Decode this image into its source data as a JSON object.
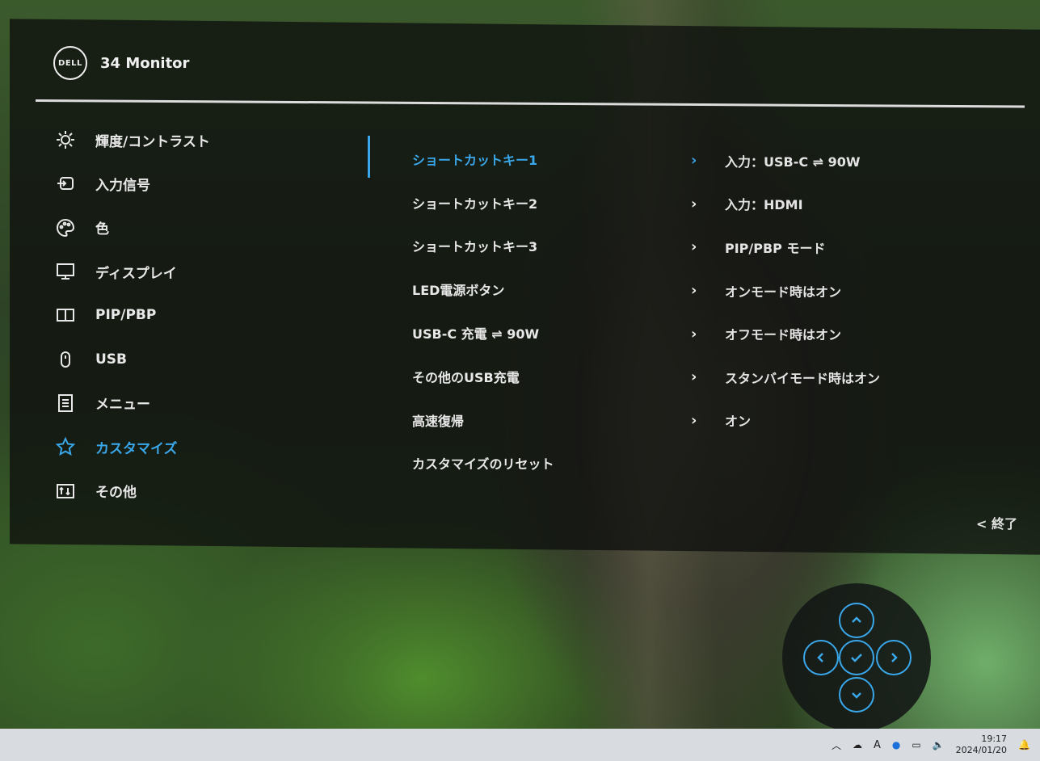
{
  "header": {
    "logo_text": "DELL",
    "title": "34 Monitor"
  },
  "categories": [
    {
      "label": "輝度/コントラスト",
      "icon": "brightness-icon",
      "active": false
    },
    {
      "label": "入力信号",
      "icon": "input-icon",
      "active": false
    },
    {
      "label": "色",
      "icon": "palette-icon",
      "active": false
    },
    {
      "label": "ディスプレイ",
      "icon": "display-icon",
      "active": false
    },
    {
      "label": "PIP/PBP",
      "icon": "pip-icon",
      "active": false
    },
    {
      "label": "USB",
      "icon": "mouse-icon",
      "active": false
    },
    {
      "label": "メニュー",
      "icon": "menu-icon",
      "active": false
    },
    {
      "label": "カスタマイズ",
      "icon": "star-icon",
      "active": true
    },
    {
      "label": "その他",
      "icon": "other-icon",
      "active": false
    }
  ],
  "items": [
    {
      "label": "ショートカットキー1",
      "value": "入力：USB-C ⇌ 90W",
      "active": true
    },
    {
      "label": "ショートカットキー2",
      "value": "入力：HDMI",
      "active": false
    },
    {
      "label": "ショートカットキー3",
      "value": "PIP/PBP モード",
      "active": false
    },
    {
      "label": "LED電源ボタン",
      "value": "オンモード時はオン",
      "active": false
    },
    {
      "label": "USB-C 充電 ⇌ 90W",
      "value": "オフモード時はオン",
      "active": false
    },
    {
      "label": "その他のUSB充電",
      "value": "スタンバイモード時はオン",
      "active": false
    },
    {
      "label": "高速復帰",
      "value": "オン",
      "active": false
    },
    {
      "label": "カスタマイズのリセット",
      "value": "",
      "active": false
    }
  ],
  "exit_label": "< 終了",
  "joystick": {
    "buttons": [
      "up-icon",
      "left-icon",
      "check-icon",
      "right-icon",
      "down-icon"
    ]
  },
  "taskbar": {
    "ime": "A",
    "time": "19:17",
    "date": "2024/01/20"
  },
  "colors": {
    "accent": "#3aa7ea",
    "osd_bg": "#0e100e",
    "text": "#e8e8e8"
  }
}
